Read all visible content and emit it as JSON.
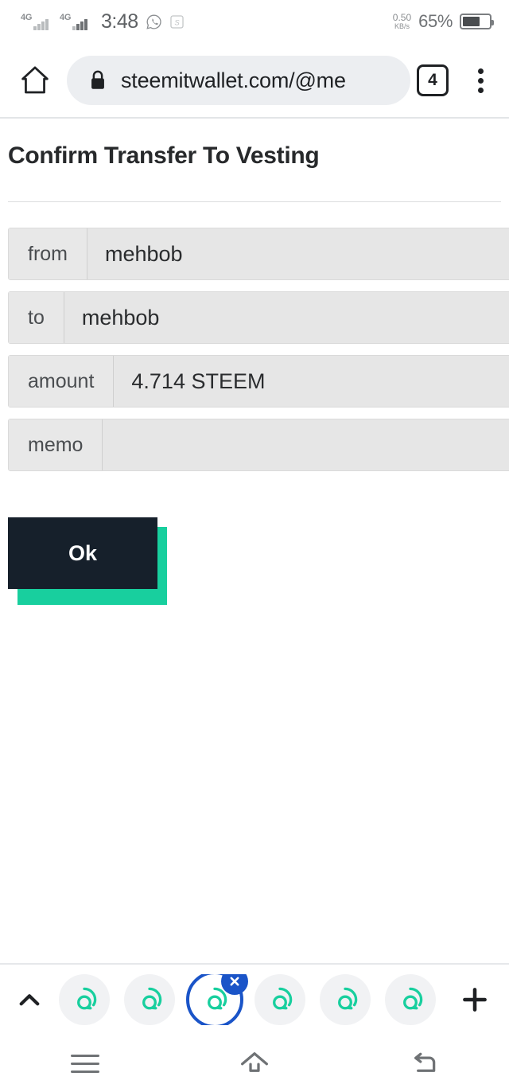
{
  "statusbar": {
    "network_label_1": "4G",
    "network_label_2": "4G",
    "time": "3:48",
    "whatsapp_icon": "whatsapp-icon",
    "app_icon": "steemit-app-icon",
    "data_speed_value": "0.50",
    "data_speed_unit": "KB/s",
    "battery_percent": "65%",
    "battery_level": 65
  },
  "toolbar": {
    "home_icon": "home-icon",
    "lock_icon": "lock-icon",
    "url": "steemitwallet.com/@me",
    "tab_count": "4",
    "menu_icon": "overflow-menu-icon"
  },
  "page": {
    "title": "Confirm Transfer To Vesting",
    "rows": [
      {
        "label": "from",
        "value": "mehbob"
      },
      {
        "label": "to",
        "value": "mehbob"
      },
      {
        "label": "amount",
        "value": "4.714 STEEM"
      },
      {
        "label": "memo",
        "value": ""
      }
    ],
    "ok_label": "Ok"
  },
  "tabstrip": {
    "expand_icon": "chevron-up-icon",
    "new_tab_icon": "plus-icon",
    "close_icon": "close-icon",
    "tabs": [
      {
        "icon": "steemit-favicon",
        "selected": false
      },
      {
        "icon": "steemit-favicon",
        "selected": false
      },
      {
        "icon": "steemit-favicon",
        "selected": true
      },
      {
        "icon": "steemit-favicon",
        "selected": false
      },
      {
        "icon": "steemit-favicon",
        "selected": false
      },
      {
        "icon": "steemit-favicon",
        "selected": false
      }
    ]
  },
  "navbar": {
    "recents_icon": "recents-icon",
    "home_icon": "home-icon",
    "back_icon": "back-icon"
  },
  "colors": {
    "accent_green": "#18cf9e",
    "button_dark": "#16202b",
    "tab_selected_blue": "#1a54c8",
    "field_bg": "#e8e8e8"
  }
}
